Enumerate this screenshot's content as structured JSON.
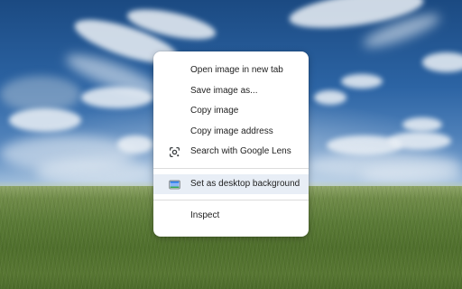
{
  "context_menu": {
    "items": [
      {
        "label": "Open image in new tab"
      },
      {
        "label": "Save image as..."
      },
      {
        "label": "Copy image"
      },
      {
        "label": "Copy image address"
      },
      {
        "label": "Search with Google Lens",
        "icon": "google-lens-icon"
      },
      {
        "label": "Set as desktop background",
        "icon": "desktop-background-icon",
        "highlighted": true
      },
      {
        "label": "Inspect"
      }
    ]
  },
  "colors": {
    "menu_background": "#ffffff",
    "highlight": "#e8eef6",
    "text": "#1f1f1f",
    "icon_blue": "#1a73e8"
  }
}
